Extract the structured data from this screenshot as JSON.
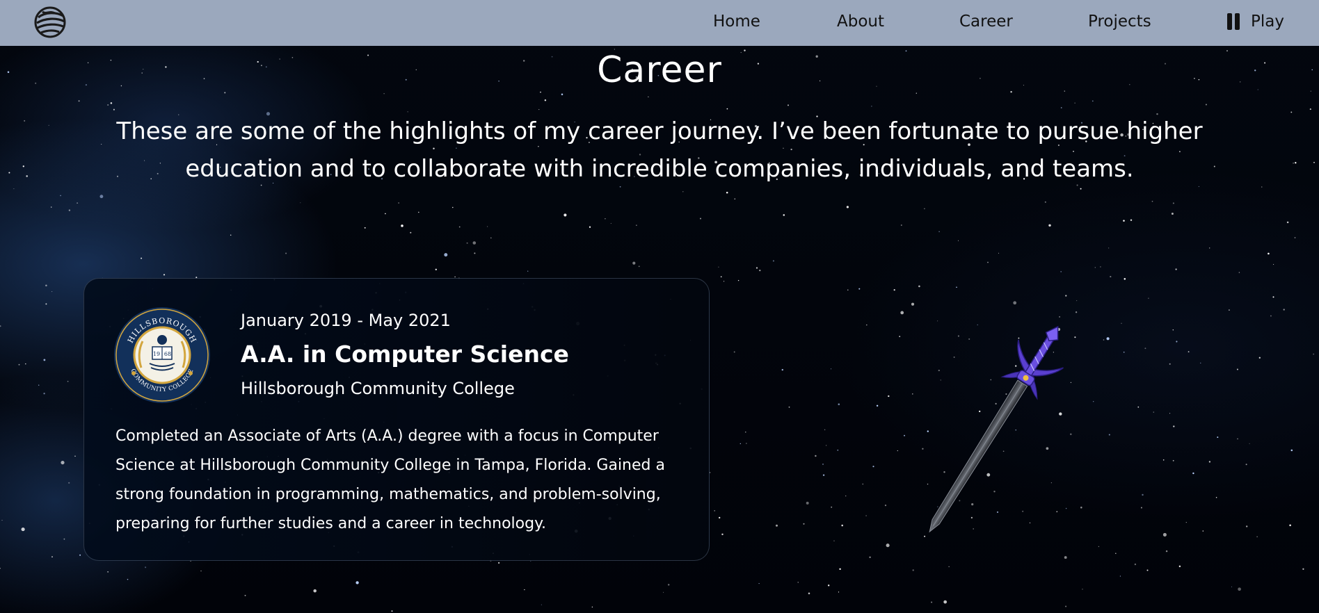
{
  "nav": {
    "logo_icon": "planet-logo-icon",
    "items": [
      {
        "label": "Home"
      },
      {
        "label": "About"
      },
      {
        "label": "Career"
      },
      {
        "label": "Projects"
      }
    ],
    "play_label": "Play",
    "play_icon": "pause-icon"
  },
  "header": {
    "title": "Career",
    "intro": "These are some of the highlights of my career journey. I’ve been fortunate to pursue higher education and to collaborate with incredible companies, individuals, and teams."
  },
  "career_entries": [
    {
      "date_range": "January 2019 - May 2021",
      "degree": "A.A. in Computer Science",
      "school": "Hillsborough Community College",
      "description": "Completed an Associate of Arts (A.A.) degree with a focus in Computer Science at Hillsborough Community College in Tampa, Florida. Gained a strong foundation in programming, mathematics, and problem-solving, preparing for further studies and a career in technology.",
      "logo": {
        "icon": "college-seal-icon",
        "top_text": "HILLSBOROUGH",
        "bottom_text": "COMMUNITY COLLEGE",
        "year_left": "19",
        "year_right": "68"
      }
    }
  ],
  "decoration": {
    "sword_icon": "sword-icon"
  },
  "colors": {
    "nav_background": "#9ba8bd",
    "nav_text": "#111111",
    "page_background": "#02050d",
    "text": "#ffffff",
    "seal_navy": "#12305a",
    "seal_gold": "#d3a63e",
    "sword_hilt": "#5a3fd0"
  }
}
